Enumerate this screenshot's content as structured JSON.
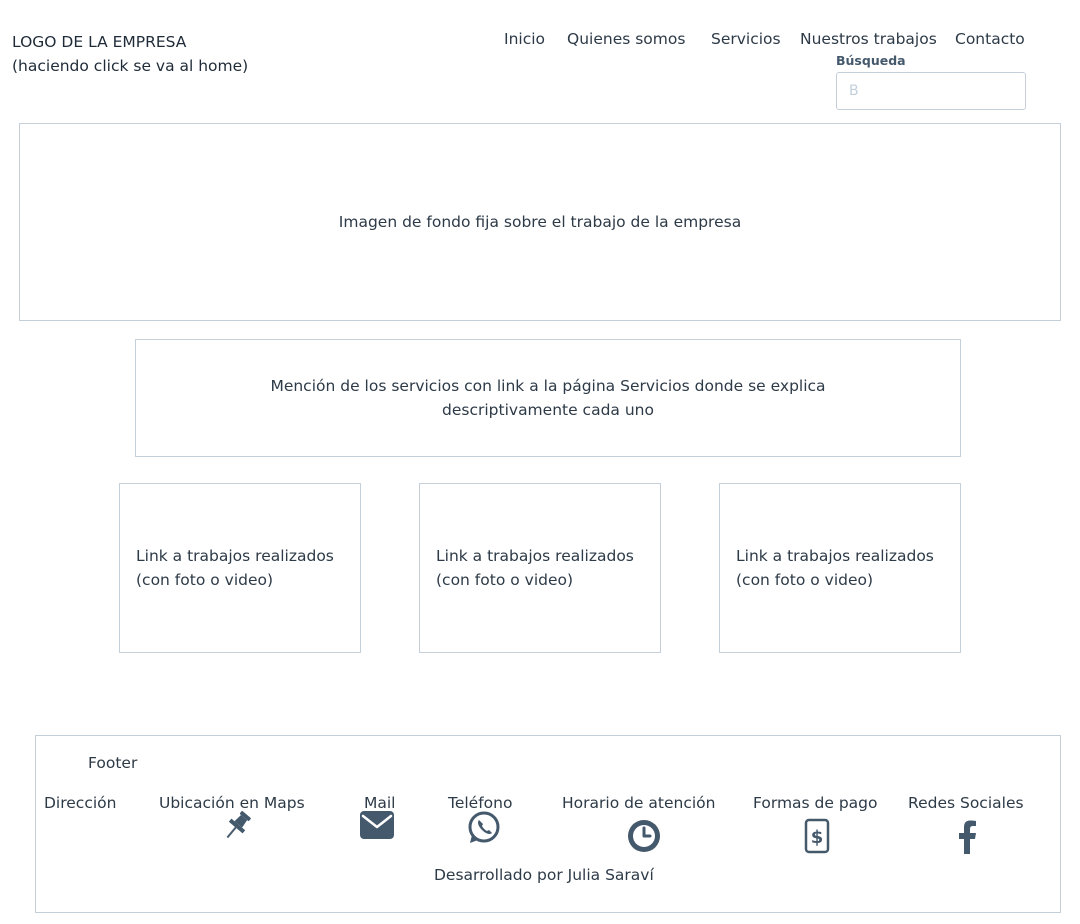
{
  "header": {
    "logo_line1": "LOGO DE LA EMPRESA",
    "logo_line2": "(haciendo click se va al home)",
    "nav": [
      "Inicio",
      "Quienes somos",
      "Servicios",
      "Nuestros trabajos",
      "Contacto"
    ],
    "search": {
      "label": "Búsqueda",
      "placeholder": "B"
    }
  },
  "hero": {
    "text": "Imagen de fondo fija sobre el trabajo de la empresa"
  },
  "services": {
    "text": "Mención de los servicios con link a la página Servicios donde se explica descriptivamente cada uno"
  },
  "cards": [
    {
      "line1": "Link a trabajos realizados",
      "line2": "(con foto o video)"
    },
    {
      "line1": "Link a trabajos realizados",
      "line2": "(con foto o video)"
    },
    {
      "line1": "Link a trabajos realizados",
      "line2": "(con foto o video)"
    }
  ],
  "footer": {
    "title": "Footer",
    "items": [
      "Dirección",
      "Ubicación en Maps",
      "Mail",
      "Teléfono",
      "Horario de atención",
      "Formas de pago",
      "Redes Sociales"
    ],
    "icons": [
      "pushpin-icon",
      "mail-icon",
      "whatsapp-icon",
      "clock-icon",
      "payment-icon",
      "facebook-icon"
    ],
    "credit": "Desarrollado por Julia Saraví"
  },
  "colors": {
    "text": "#2d3a47",
    "border": "#c5cfd9",
    "icon": "#45596d"
  }
}
